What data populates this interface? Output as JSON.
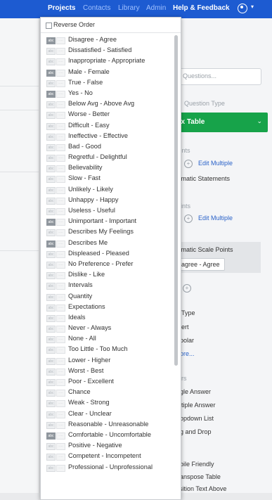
{
  "nav": {
    "items": [
      "Projects",
      "Contacts",
      "Library",
      "Admin",
      "Help & Feedback"
    ],
    "user_caret": "▾"
  },
  "right_panel": {
    "search_placeholder": "rch Questions...",
    "question_type_heading": "Question Type",
    "question_type_value": "atrix Table",
    "statements_heading": "ments",
    "edit_multiple_1": "Edit Multiple",
    "automatic_statements": "utomatic Statements",
    "scale_points_heading": "Points",
    "edit_multiple_2": "Edit Multiple",
    "automatic_scale_points": "utomatic Scale Points",
    "scale_select": "Disagree - Agree",
    "type_heading": "Type",
    "type_opt_1": "ert",
    "type_opt_2": "polar",
    "type_more": "ore...",
    "answers_heading": "rs",
    "answer_1": "gle Answer",
    "answer_2": "ltiple Answer",
    "answer_3": "opdown List",
    "answer_4": "g and Drop",
    "format_1": "bile Friendly",
    "format_2": "anspose Table",
    "format_3": "Position Text Above"
  },
  "dropdown": {
    "reverse_order_label": "Reverse Order",
    "badge_1": "abc",
    "badge_2": "····",
    "options": [
      "Disagree - Agree",
      "Dissatisfied - Satisfied",
      "Inappropriate - Appropriate",
      "Male - Female",
      "True - False",
      "Yes - No",
      "Below Avg - Above Avg",
      "Worse - Better",
      "Difficult - Easy",
      "Ineffective - Effective",
      "Bad - Good",
      "Regretful - Delightful",
      "Believability",
      "Slow - Fast",
      "Unlikely - Likely",
      "Unhappy - Happy",
      "Useless - Useful",
      "Unimportant - Important",
      "Describes My Feelings",
      "Describes Me",
      "Displeased - Pleased",
      "No Preference - Prefer",
      "Dislike - Like",
      "Intervals",
      "Quantity",
      "Expectations",
      "Ideals",
      "Never - Always",
      "None - All",
      "Too Little - Too Much",
      "Lower - Higher",
      "Worst - Best",
      "Poor - Excellent",
      "Chance",
      "Weak - Strong",
      "Clear - Unclear",
      "Reasonable - Unreasonable",
      "Comfortable - Uncomfortable",
      "Positive - Negative",
      "Competent - Incompetent",
      "Professional - Unprofessional"
    ],
    "highlighted_indices": [
      0,
      3,
      5,
      17,
      19,
      37
    ]
  },
  "colors": {
    "nav_bg": "#1d5bd1",
    "accent_green": "#17a34a",
    "link_blue": "#2b63c9"
  }
}
